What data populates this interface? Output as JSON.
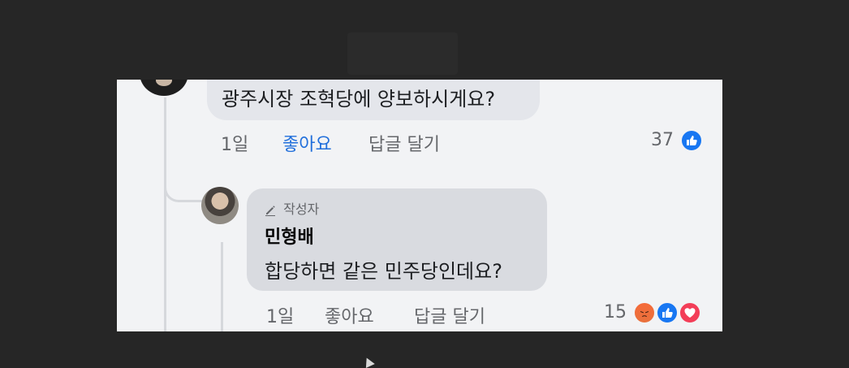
{
  "comment": {
    "text": "광주시장 조혁당에 양보하시게요?",
    "time": "1일",
    "like_label": "좋아요",
    "reply_label": "답글 달기",
    "reaction_count": "37",
    "reactions": [
      "like-icon"
    ],
    "like_active_color": "#216fdb"
  },
  "reply": {
    "badge_label": "작성자",
    "author": "민형배",
    "text": "합당하면 같은 민주당인데요?",
    "time": "1일",
    "like_label": "좋아요",
    "reply_label": "답글 달기",
    "reaction_count": "15",
    "reactions": [
      "angry-icon",
      "like-icon",
      "love-icon"
    ]
  },
  "colors": {
    "background": "#262626",
    "panel": "#f2f3f5",
    "bubble": "#e4e6eb",
    "like_blue": "#1877f2",
    "love_red": "#f33e58",
    "angry_orange": "#f56a3a"
  }
}
